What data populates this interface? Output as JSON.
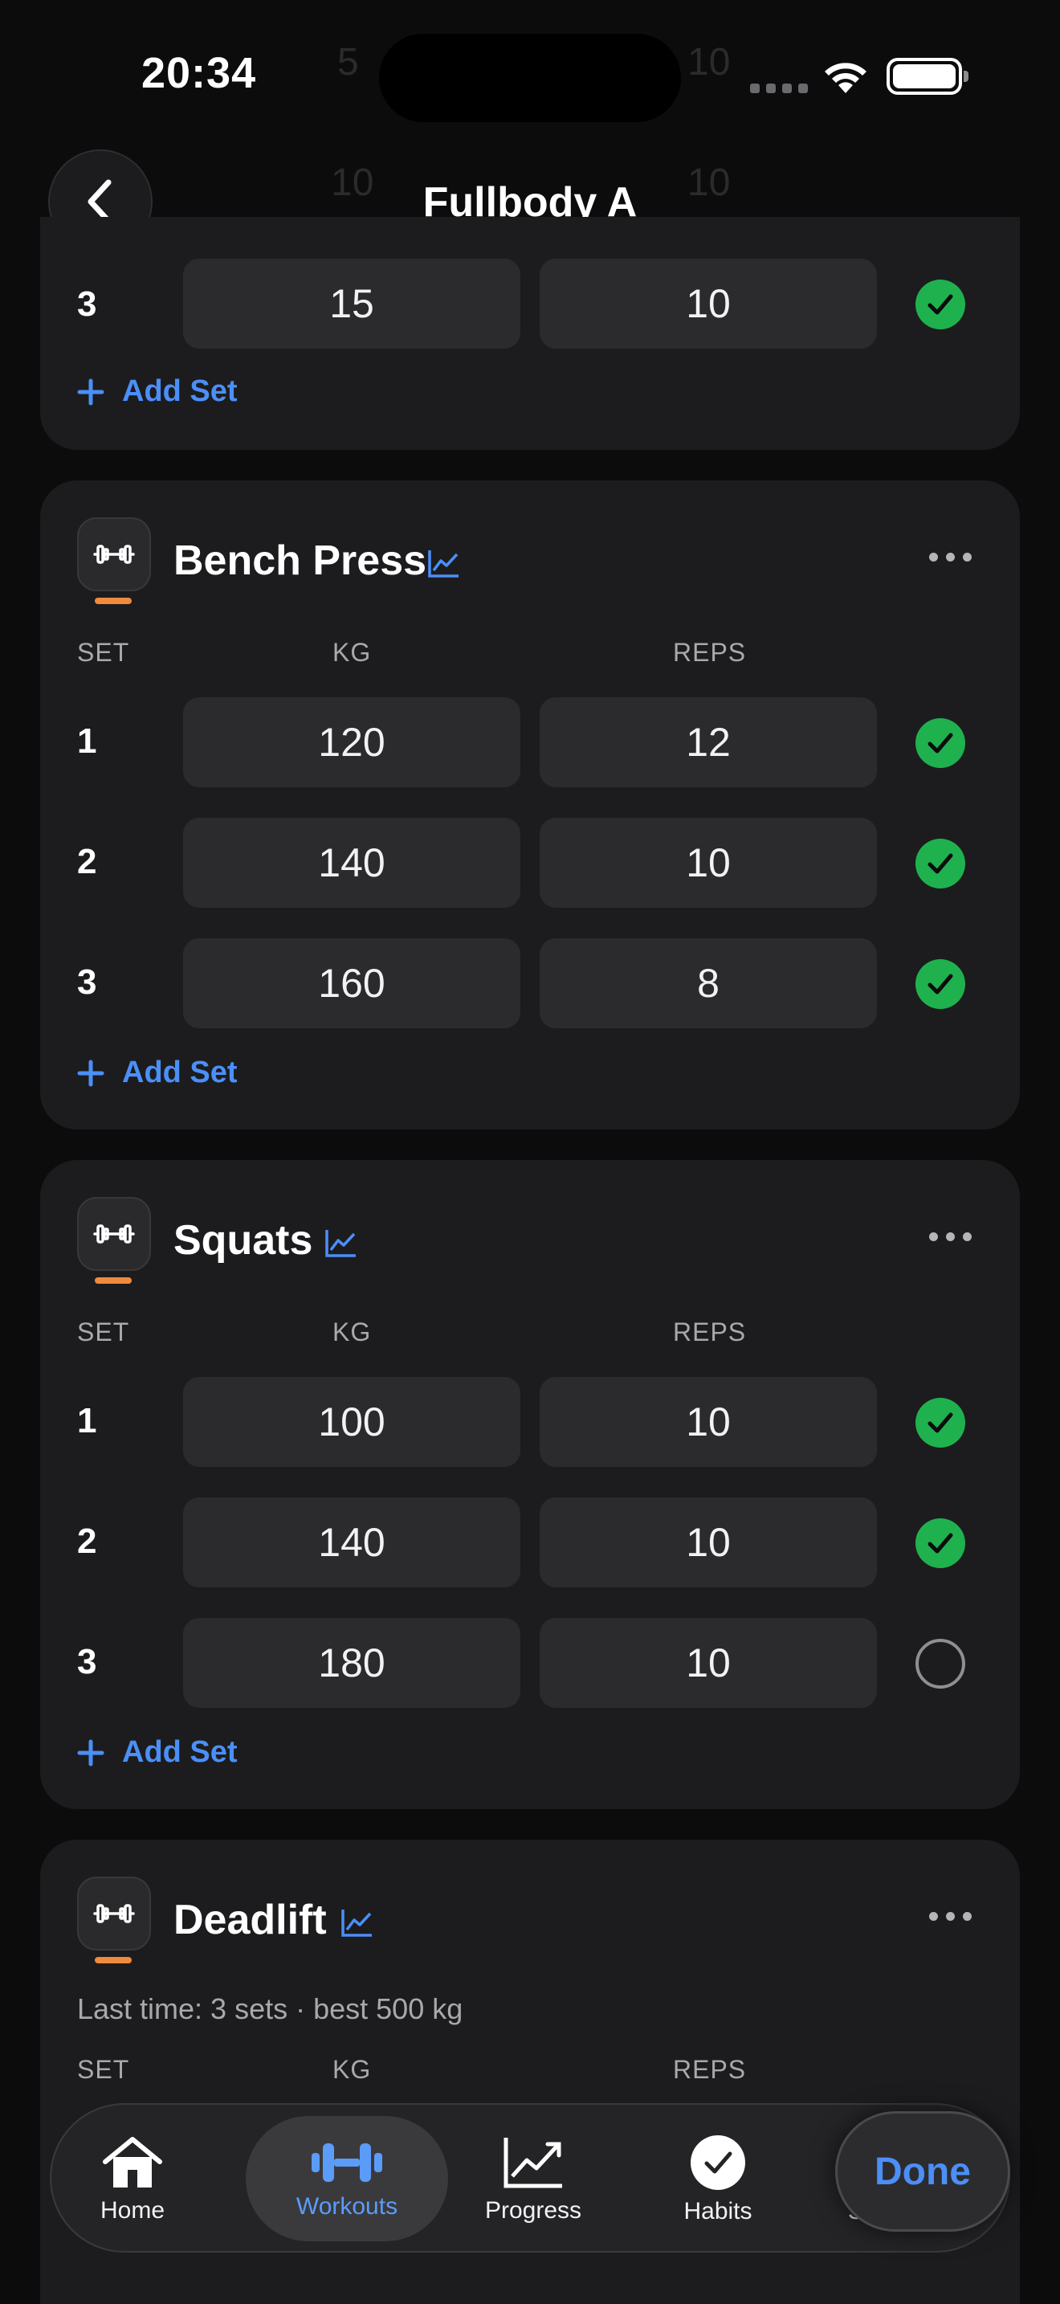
{
  "status": {
    "time": "20:34"
  },
  "header": {
    "title": "Fullbody A"
  },
  "columns": {
    "set": "SET",
    "kg": "KG",
    "reps": "REPS"
  },
  "add_set_label": "Add Set",
  "top_partial": {
    "set": {
      "num": "3",
      "kg": "15",
      "reps": "10",
      "completed": true
    }
  },
  "exercises": [
    {
      "name": "Bench Press",
      "sets": [
        {
          "num": "1",
          "kg": "120",
          "reps": "12",
          "completed": true
        },
        {
          "num": "2",
          "kg": "140",
          "reps": "10",
          "completed": true
        },
        {
          "num": "3",
          "kg": "160",
          "reps": "8",
          "completed": true
        }
      ]
    },
    {
      "name": "Squats",
      "sets": [
        {
          "num": "1",
          "kg": "100",
          "reps": "10",
          "completed": true
        },
        {
          "num": "2",
          "kg": "140",
          "reps": "10",
          "completed": true
        },
        {
          "num": "3",
          "kg": "180",
          "reps": "10",
          "completed": false
        }
      ]
    },
    {
      "name": "Deadlift",
      "last_time": "Last time: 3 sets · best 500 kg",
      "sets": []
    }
  ],
  "tabs": [
    {
      "label": "Home",
      "icon": "house-icon",
      "active": false
    },
    {
      "label": "Workouts",
      "icon": "dumbbell-icon",
      "active": true
    },
    {
      "label": "Progress",
      "icon": "chart-line-icon",
      "active": false
    },
    {
      "label": "Habits",
      "icon": "checkmark-circle-icon",
      "active": false
    }
  ],
  "done_label": "Done",
  "settings_partial_label": "Se…g",
  "colors": {
    "accent": "#4b8ff7",
    "success": "#1fb14e",
    "exercise_marker": "#f08a3c",
    "card": "#1c1c1e"
  }
}
